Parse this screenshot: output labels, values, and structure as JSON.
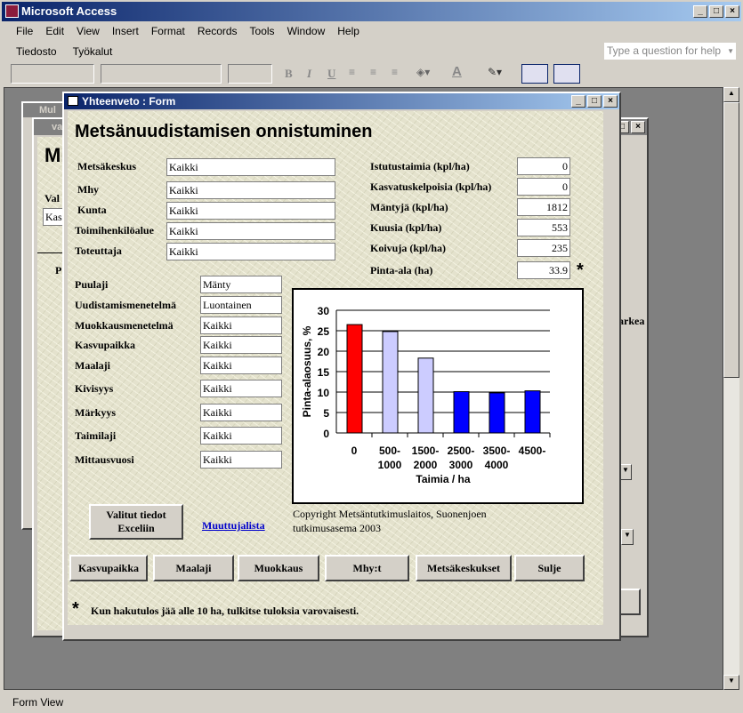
{
  "app": {
    "title": "Microsoft Access",
    "status": "Form View",
    "help_placeholder": "Type a question for help"
  },
  "menu": [
    "File",
    "Edit",
    "View",
    "Insert",
    "Format",
    "Records",
    "Tools",
    "Window",
    "Help"
  ],
  "menu2": [
    "Tiedosto",
    "Työkalut"
  ],
  "toolbar": {
    "bold": "B",
    "italic": "I",
    "underline": "U"
  },
  "bg_windows": {
    "win1_title": "Mul",
    "win2_title": "va",
    "heading": "Mi",
    "label": "Val",
    "input": "Kas",
    "group_label": "P",
    "text_fragment": "arkea"
  },
  "form": {
    "title": "Yhteenveto : Form",
    "heading": "Metsänuudistamisen onnistuminen",
    "left_fields": [
      {
        "label": "Metsäkeskus",
        "value": "Kaikki"
      },
      {
        "label": "Mhy",
        "value": "Kaikki"
      },
      {
        "label": "Kunta",
        "value": "Kaikki"
      },
      {
        "label": "Toimihenkilöalue",
        "value": "Kaikki"
      },
      {
        "label": "Toteuttaja",
        "value": "Kaikki"
      }
    ],
    "filter_fields": [
      {
        "label": "Puulaji",
        "value": "Mänty"
      },
      {
        "label": "Uudistamismenetelmä",
        "value": "Luontainen"
      },
      {
        "label": "Muokkausmenetelmä",
        "value": "Kaikki"
      },
      {
        "label": "Kasvupaikka",
        "value": "Kaikki"
      },
      {
        "label": "Maalaji",
        "value": "Kaikki"
      },
      {
        "label": "Kivisyys",
        "value": "Kaikki"
      },
      {
        "label": "Märkyys",
        "value": "Kaikki"
      },
      {
        "label": "Taimilaji",
        "value": "Kaikki"
      },
      {
        "label": "Mittausvuosi",
        "value": "Kaikki"
      }
    ],
    "stats": [
      {
        "label": "Istutustaimia (kpl/ha)",
        "value": "0"
      },
      {
        "label": "Kasvatuskelpoisia (kpl/ha)",
        "value": "0"
      },
      {
        "label": "Mäntyjä (kpl/ha)",
        "value": "1812"
      },
      {
        "label": "Kuusia (kpl/ha)",
        "value": "553"
      },
      {
        "label": "Koivuja (kpl/ha)",
        "value": "235"
      },
      {
        "label": "Pinta-ala (ha)",
        "value": "33.9"
      }
    ],
    "asterisk": "*",
    "excel_button": "Valitut tiedot Exceliin",
    "link": "Muuttujalista",
    "copyright": "Copyright Metsäntutkimuslaitos, Suonenjoen tutkimusasema 2003",
    "buttons": [
      "Kasvupaikka",
      "Maalaji",
      "Muokkaus",
      "Mhy:t",
      "Metsäkeskukset",
      "Sulje"
    ],
    "footnote": "Kun hakutulos jää alle 10 ha, tulkitse tuloksia varovaisesti."
  },
  "chart_data": {
    "type": "bar",
    "categories": [
      "0",
      "500-1000",
      "1500-2000",
      "2500-3000",
      "3500-4000",
      "4500-"
    ],
    "category_lines": [
      [
        "0",
        ""
      ],
      [
        "500-",
        "1000"
      ],
      [
        "1500-",
        "2000"
      ],
      [
        "2500-",
        "3000"
      ],
      [
        "3500-",
        "4000"
      ],
      [
        "4500-",
        ""
      ]
    ],
    "values": [
      26.5,
      24.8,
      18.3,
      10.1,
      9.8,
      10.3
    ],
    "colors": [
      "#ff0000",
      "#ccccff",
      "#ccccff",
      "#0000ff",
      "#0000ff",
      "#0000ff"
    ],
    "xlabel": "Taimia / ha",
    "ylabel": "Pinta-alaosuus, %",
    "ylim": [
      0,
      30
    ],
    "yticks": [
      0,
      5,
      10,
      15,
      20,
      25,
      30
    ],
    "grid": true
  }
}
